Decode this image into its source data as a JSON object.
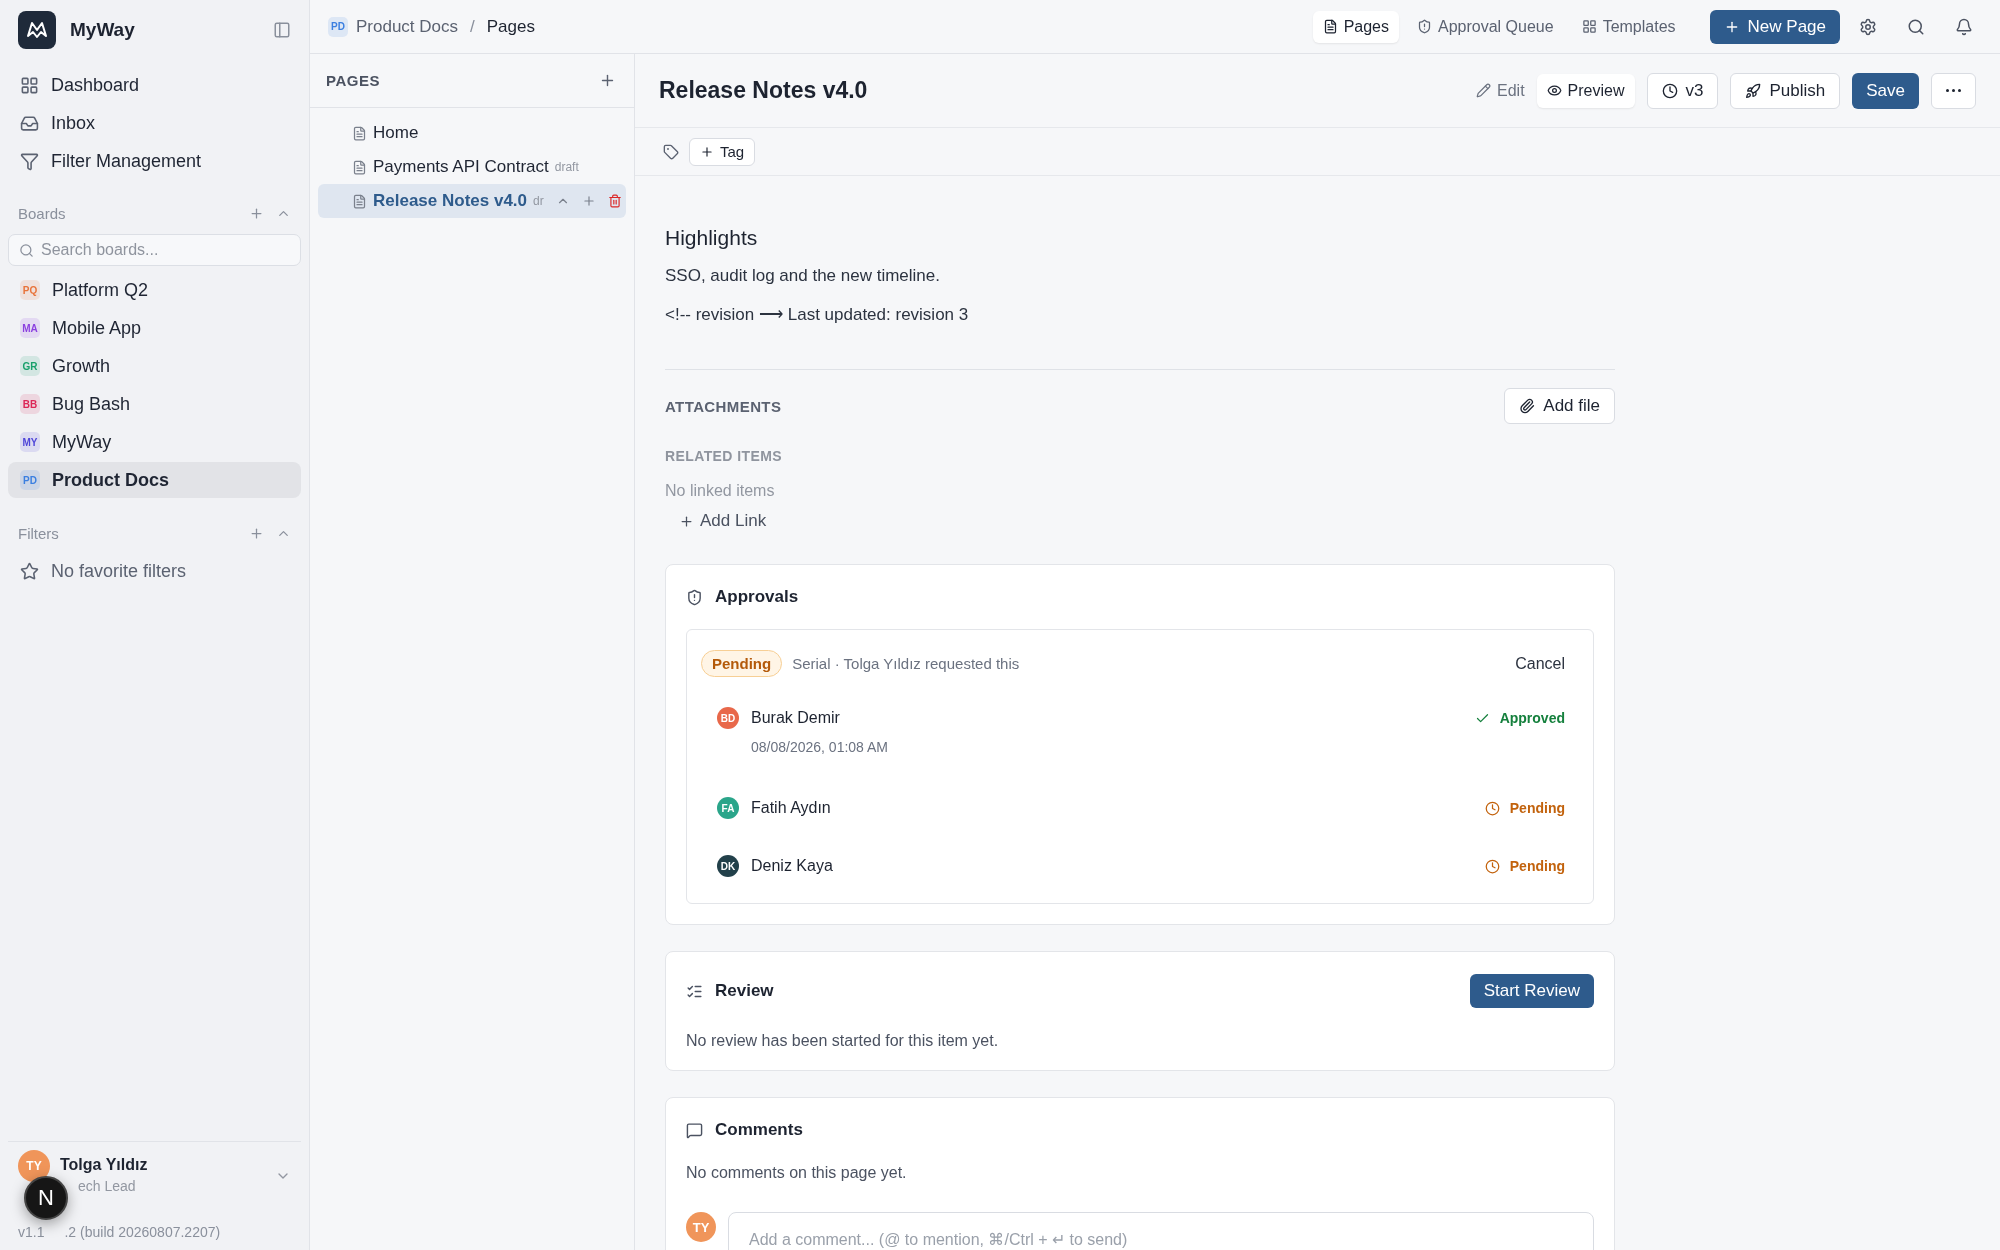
{
  "sidebar": {
    "app_name": "MyWay",
    "nav": [
      {
        "label": "Dashboard"
      },
      {
        "label": "Inbox"
      },
      {
        "label": "Filter Management"
      }
    ],
    "boards": {
      "title": "Boards",
      "search_placeholder": "Search boards...",
      "items": [
        {
          "initials": "PQ",
          "label": "Platform Q2",
          "color": "#e8733a",
          "selected": false
        },
        {
          "initials": "MA",
          "label": "Mobile App",
          "color": "#8b3fe0",
          "selected": false
        },
        {
          "initials": "GR",
          "label": "Growth",
          "color": "#17a06a",
          "selected": false
        },
        {
          "initials": "BB",
          "label": "Bug Bash",
          "color": "#dc2656",
          "selected": false
        },
        {
          "initials": "MY",
          "label": "MyWay",
          "color": "#4f46d8",
          "selected": false
        },
        {
          "initials": "PD",
          "label": "Product Docs",
          "color": "#3b7fe0",
          "selected": true
        }
      ]
    },
    "filters": {
      "title": "Filters",
      "empty": "No favorite filters"
    },
    "user": {
      "initials": "TY",
      "name": "Tolga Yıldız",
      "role": "ech Lead",
      "version_start": "v1.1",
      "version_end": ".2 (build 20260807.2207)"
    },
    "dev_badge": "N"
  },
  "breadcrumb": {
    "initials": "PD",
    "items": [
      "Product Docs",
      "Pages"
    ],
    "separator": "/"
  },
  "top_nav": [
    {
      "label": "Pages",
      "selected": true
    },
    {
      "label": "Approval Queue",
      "selected": false
    },
    {
      "label": "Templates",
      "selected": false
    }
  ],
  "new_page": "New Page",
  "pages_panel": {
    "title": "PAGES",
    "pages": [
      {
        "label": "Home",
        "selected": false
      },
      {
        "label": "Payments API Contract",
        "badge": "draft",
        "selected": false
      },
      {
        "label": "Release Notes v4.0",
        "badge": "dr",
        "selected": true
      }
    ]
  },
  "page": {
    "title": "Release Notes v4.0",
    "mode_tabs": [
      {
        "label": "Edit",
        "selected": false
      },
      {
        "label": "Preview",
        "selected": true
      }
    ],
    "version": "v3",
    "publish": "Publish",
    "save": "Save",
    "tag_button": "Tag",
    "heading": "Highlights",
    "paragraphs": [
      "SSO, audit log and the new timeline.",
      "<!-- revision ⟶ Last updated: revision 3"
    ],
    "attachments": {
      "title": "ATTACHMENTS",
      "button": "Add file"
    },
    "related": {
      "title": "RELATED ITEMS",
      "empty": "No linked items",
      "add": "Add Link"
    },
    "approvals": {
      "title": "Approvals",
      "status": "Pending",
      "meta": "Serial · Tolga Yıldız requested this",
      "cancel": "Cancel",
      "approvers": [
        {
          "initials": "BD",
          "name": "Burak Demir",
          "color": "#e8684a",
          "kind": "approved",
          "status_label": "Approved",
          "time": "08/08/2026, 01:08 AM"
        },
        {
          "initials": "FA",
          "name": "Fatih Aydın",
          "color": "#2aa58a",
          "kind": "pending",
          "status_label": "Pending"
        },
        {
          "initials": "DK",
          "name": "Deniz Kaya",
          "color": "#22404a",
          "kind": "pending",
          "status_label": "Pending"
        }
      ]
    },
    "review": {
      "title": "Review",
      "button": "Start Review",
      "empty": "No review has been started for this item yet."
    },
    "comments": {
      "title": "Comments",
      "empty": "No comments on this page yet.",
      "avatar": "TY",
      "placeholder": "Add a comment... (@ to mention, ⌘/Ctrl + ↵ to send)"
    }
  }
}
